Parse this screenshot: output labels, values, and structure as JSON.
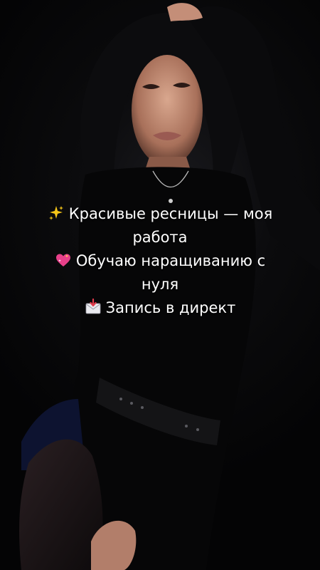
{
  "story": {
    "photo_subject": "woman-portrait",
    "caption": {
      "line1": "Красивые ресницы — моя",
      "line1b": "работа",
      "line2": "Обучаю наращиванию с",
      "line2b": "нуля",
      "line3": "Запись в директ"
    },
    "icons": [
      "sparkles-icon",
      "sparkling-heart-icon",
      "incoming-envelope-icon"
    ],
    "colors": {
      "background": "#050506",
      "text": "#ffffff",
      "heart": "#e8408a",
      "sparkle": "#f5c518"
    }
  }
}
